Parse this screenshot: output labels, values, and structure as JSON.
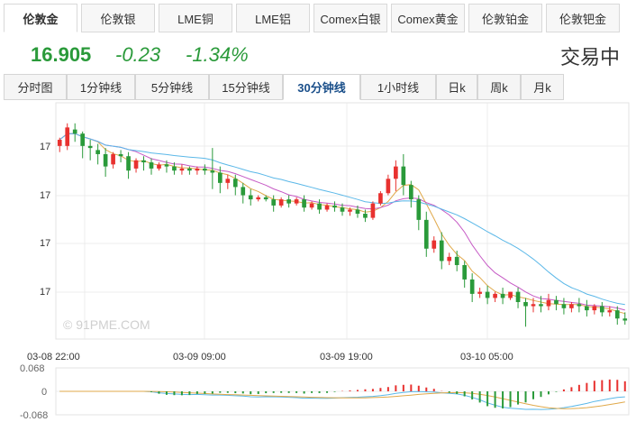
{
  "product_tabs": [
    {
      "label": "伦敦金",
      "active": true
    },
    {
      "label": "伦敦银"
    },
    {
      "label": "LME铜"
    },
    {
      "label": "LME铝"
    },
    {
      "label": "Comex白银"
    },
    {
      "label": "Comex黄金"
    },
    {
      "label": "伦敦铂金"
    },
    {
      "label": "伦敦钯金"
    }
  ],
  "quote": {
    "price": "16.905",
    "change": "-0.23",
    "change_pct": "-1.34%",
    "status": "交易中"
  },
  "period_tabs": [
    {
      "label": "分时图"
    },
    {
      "label": "1分钟线"
    },
    {
      "label": "5分钟线"
    },
    {
      "label": "15分钟线"
    },
    {
      "label": "30分钟线",
      "active": true
    },
    {
      "label": "1小时线"
    },
    {
      "label": "日k"
    },
    {
      "label": "周k"
    },
    {
      "label": "月k"
    }
  ],
  "watermark": "© 91PME.COM",
  "colors": {
    "up": "#e8312f",
    "down": "#2a9a3a",
    "ma1": "#e0a94a",
    "ma2": "#c65ac5",
    "ma3": "#5bb8e8"
  },
  "chart_data": {
    "type": "candlestick",
    "y_tick_labels": [
      "17",
      "17",
      "17",
      "17"
    ],
    "x_tick_labels": [
      "03-08 22:00",
      "03-09 09:00",
      "03-09 19:00",
      "03-10 05:00"
    ],
    "candles": [
      [
        17.24,
        17.28,
        17.27,
        17.21
      ],
      [
        17.24,
        17.35,
        17.33,
        17.22
      ],
      [
        17.32,
        17.35,
        17.3,
        17.26
      ],
      [
        17.3,
        17.31,
        17.24,
        17.18
      ],
      [
        17.24,
        17.27,
        17.23,
        17.17
      ],
      [
        17.22,
        17.25,
        17.2,
        17.15
      ],
      [
        17.2,
        17.23,
        17.14,
        17.09
      ],
      [
        17.15,
        17.21,
        17.2,
        17.13
      ],
      [
        17.2,
        17.22,
        17.19,
        17.16
      ],
      [
        17.19,
        17.21,
        17.12,
        17.08
      ],
      [
        17.13,
        17.18,
        17.17,
        17.11
      ],
      [
        17.17,
        17.19,
        17.16,
        17.12
      ],
      [
        17.16,
        17.18,
        17.13,
        17.1
      ],
      [
        17.13,
        17.16,
        17.15,
        17.12
      ],
      [
        17.15,
        17.17,
        17.14,
        17.11
      ],
      [
        17.14,
        17.16,
        17.12,
        17.1
      ],
      [
        17.12,
        17.15,
        17.13,
        17.1
      ],
      [
        17.13,
        17.14,
        17.12,
        17.1
      ],
      [
        17.12,
        17.14,
        17.13,
        17.1
      ],
      [
        17.13,
        17.15,
        17.12,
        17.1
      ],
      [
        17.12,
        17.23,
        17.11,
        17.03
      ],
      [
        17.11,
        17.14,
        17.06,
        17.01
      ],
      [
        17.06,
        17.1,
        17.08,
        17.03
      ],
      [
        17.08,
        17.1,
        17.04,
        17.0
      ],
      [
        17.04,
        17.06,
        17.0,
        16.96
      ],
      [
        17.0,
        17.03,
        16.98,
        16.95
      ],
      [
        16.98,
        17.0,
        16.99,
        16.97
      ],
      [
        16.99,
        17.0,
        16.98,
        16.97
      ],
      [
        16.98,
        17.0,
        16.95,
        16.92
      ],
      [
        16.95,
        16.99,
        16.98,
        16.94
      ],
      [
        16.98,
        17.0,
        16.96,
        16.94
      ],
      [
        16.96,
        16.99,
        16.98,
        16.95
      ],
      [
        16.98,
        17.0,
        16.94,
        16.92
      ],
      [
        16.94,
        16.97,
        16.96,
        16.93
      ],
      [
        16.96,
        16.98,
        16.93,
        16.91
      ],
      [
        16.93,
        16.96,
        16.95,
        16.92
      ],
      [
        16.95,
        16.97,
        16.94,
        16.92
      ],
      [
        16.94,
        16.96,
        16.92,
        16.9
      ],
      [
        16.92,
        16.94,
        16.93,
        16.9
      ],
      [
        16.93,
        16.95,
        16.91,
        16.89
      ],
      [
        16.91,
        16.93,
        16.89,
        16.87
      ],
      [
        16.89,
        16.97,
        16.96,
        16.88
      ],
      [
        16.96,
        17.02,
        17.01,
        16.95
      ],
      [
        17.01,
        17.1,
        17.08,
        17.0
      ],
      [
        17.08,
        17.17,
        17.14,
        17.02
      ],
      [
        17.14,
        17.2,
        17.05,
        17.0
      ],
      [
        17.05,
        17.07,
        16.98,
        16.94
      ],
      [
        16.98,
        17.0,
        16.88,
        16.83
      ],
      [
        16.88,
        16.92,
        16.74,
        16.7
      ],
      [
        16.74,
        16.8,
        16.78,
        16.72
      ],
      [
        16.78,
        16.82,
        16.68,
        16.64
      ],
      [
        16.68,
        16.72,
        16.7,
        16.66
      ],
      [
        16.7,
        16.73,
        16.66,
        16.63
      ],
      [
        16.66,
        16.68,
        16.59,
        16.55
      ],
      [
        16.59,
        16.62,
        16.52,
        16.48
      ],
      [
        16.52,
        16.55,
        16.53,
        16.5
      ],
      [
        16.53,
        16.56,
        16.5,
        16.47
      ],
      [
        16.5,
        16.53,
        16.52,
        16.48
      ],
      [
        16.52,
        16.55,
        16.5,
        16.47
      ],
      [
        16.5,
        16.53,
        16.53,
        16.49
      ],
      [
        16.53,
        16.55,
        16.48,
        16.45
      ],
      [
        16.48,
        16.5,
        16.46,
        16.36
      ],
      [
        16.46,
        16.5,
        16.47,
        16.43
      ],
      [
        16.47,
        16.51,
        16.46,
        16.43
      ],
      [
        16.46,
        16.52,
        16.49,
        16.44
      ],
      [
        16.49,
        16.51,
        16.47,
        16.44
      ],
      [
        16.47,
        16.5,
        16.45,
        16.42
      ],
      [
        16.45,
        16.48,
        16.47,
        16.43
      ],
      [
        16.47,
        16.5,
        16.46,
        16.43
      ],
      [
        16.46,
        16.49,
        16.44,
        16.41
      ],
      [
        16.44,
        16.47,
        16.46,
        16.42
      ],
      [
        16.46,
        16.48,
        16.43,
        16.41
      ],
      [
        16.43,
        16.46,
        16.44,
        16.41
      ],
      [
        16.44,
        16.46,
        16.4,
        16.37
      ],
      [
        16.4,
        16.43,
        16.39,
        16.37
      ]
    ],
    "indicator": {
      "ticks": [
        "0.068",
        "0",
        "-0.068"
      ],
      "range": [
        -0.068,
        0.068
      ]
    }
  }
}
